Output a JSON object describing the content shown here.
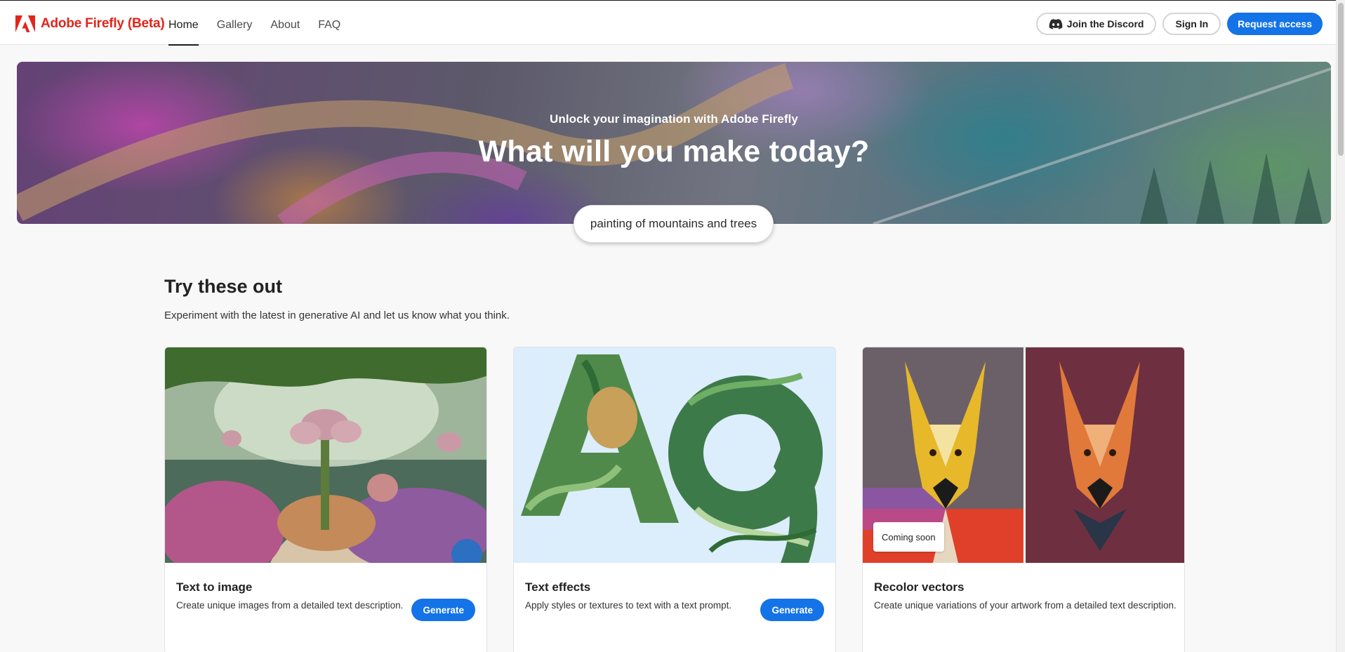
{
  "header": {
    "brand": "Adobe Firefly (Beta)",
    "nav": [
      {
        "label": "Home",
        "active": true
      },
      {
        "label": "Gallery",
        "active": false
      },
      {
        "label": "About",
        "active": false
      },
      {
        "label": "FAQ",
        "active": false
      }
    ],
    "discord_label": "Join the Discord",
    "signin_label": "Sign In",
    "request_label": "Request access"
  },
  "hero": {
    "subtitle": "Unlock your imagination with Adobe Firefly",
    "title": "What will you make today?",
    "prompt": "painting of mountains and trees"
  },
  "section": {
    "title": "Try these out",
    "description": "Experiment with the latest in generative AI and let us know what you think."
  },
  "cards": [
    {
      "title": "Text to image",
      "description": "Create unique images from a detailed text description.",
      "button": "Generate"
    },
    {
      "title": "Text effects",
      "description": "Apply styles or textures to text with a text prompt.",
      "button": "Generate"
    },
    {
      "title": "Recolor vectors",
      "description": "Create unique variations of your artwork from a detailed text description.",
      "badge": "Coming soon"
    }
  ],
  "colors": {
    "brand": "#e1251b",
    "primary": "#1473e6",
    "background": "#f8f8f8"
  },
  "icons": [
    "adobe-logo-icon",
    "discord-icon"
  ]
}
